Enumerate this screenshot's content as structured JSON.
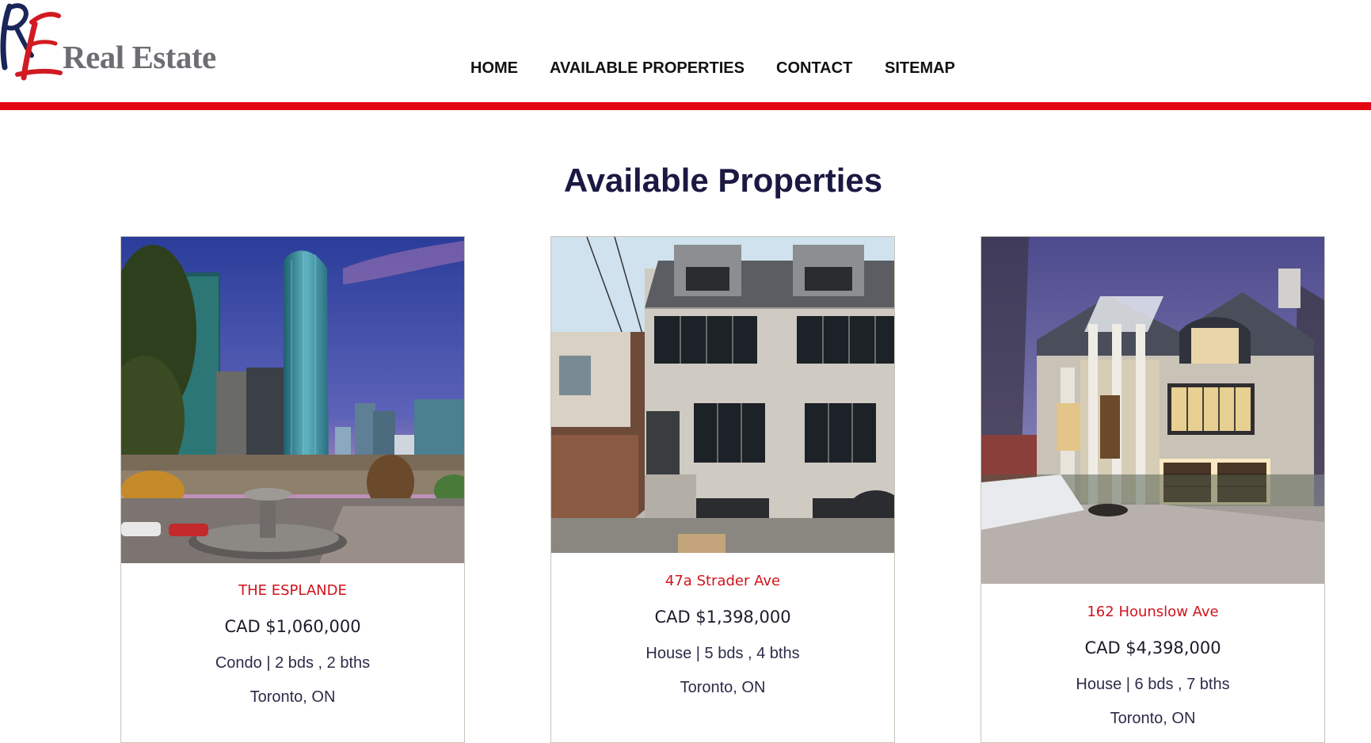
{
  "brand": {
    "name": "Real Estate",
    "monogram": "RE"
  },
  "nav": {
    "items": [
      {
        "label": "HOME"
      },
      {
        "label": "AVAILABLE PROPERTIES"
      },
      {
        "label": "CONTACT"
      },
      {
        "label": "SITEMAP"
      }
    ]
  },
  "page": {
    "title": "Available Properties"
  },
  "listings": [
    {
      "title": "THE ESPLANDE",
      "price": "CAD $1,060,000",
      "details": "Condo | 2 bds , 2 bths",
      "location": "Toronto, ON",
      "photo": "condo-tower-photo"
    },
    {
      "title": "47a Strader Ave",
      "price": "CAD $1,398,000",
      "details": "House | 5 bds , 4 bths",
      "location": "Toronto, ON",
      "photo": "brick-house-photo"
    },
    {
      "title": "162 Hounslow Ave",
      "price": "CAD $4,398,000",
      "details": "House | 6 bds , 7 bths",
      "location": "Toronto, ON",
      "photo": "stone-mansion-photo"
    }
  ],
  "colors": {
    "accent": "#e30613",
    "title": "#1a1943",
    "listing_title": "#d0141c"
  }
}
